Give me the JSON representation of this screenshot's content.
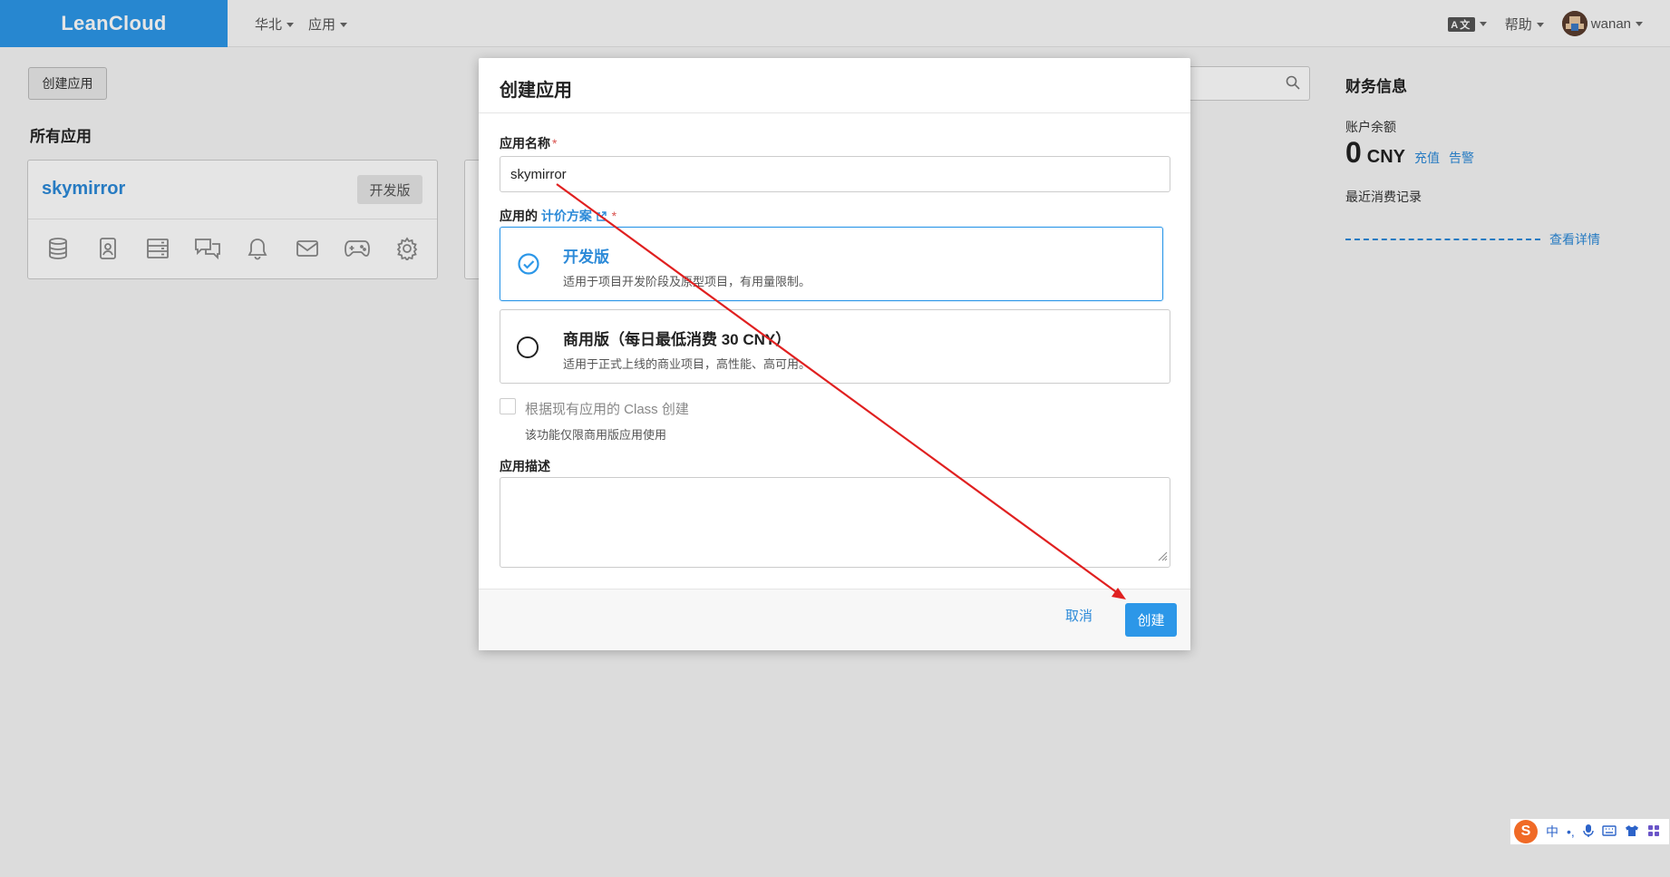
{
  "navbar": {
    "brand": "LeanCloud",
    "region": "华北",
    "apps": "应用",
    "lang_icon": "A文",
    "help": "帮助",
    "user": "wanan"
  },
  "page": {
    "create_button": "创建应用",
    "all_apps_title": "所有应用",
    "app_card": {
      "name": "skymirror",
      "badge": "开发版"
    }
  },
  "finance": {
    "title": "财务信息",
    "balance_label": "账户余额",
    "balance_value": "0",
    "currency": "CNY",
    "recharge": "充值",
    "alert": "告警",
    "recent_label": "最近消费记录",
    "details": "查看详情"
  },
  "modal": {
    "title": "创建应用",
    "name_label": "应用名称",
    "name_value": "skymirror",
    "plan_label_prefix": "应用的",
    "plan_link": "计价方案",
    "required_mark": "*",
    "plans": [
      {
        "title": "开发版",
        "desc": "适用于项目开发阶段及原型项目，有用量限制。",
        "selected": true
      },
      {
        "title": "商用版（每日最低消费 30 CNY）",
        "desc": "适用于正式上线的商业项目，高性能、高可用。",
        "selected": false
      }
    ],
    "class_checkbox_label": "根据现有应用的 Class 创建",
    "class_checkbox_help": "该功能仅限商用版应用使用",
    "desc_label": "应用描述",
    "cancel": "取消",
    "create": "创建"
  },
  "ime": {
    "mode": "中",
    "punct": "•,"
  },
  "colors": {
    "primary": "#2c97e8",
    "link": "#2c8ad8",
    "annotation": "#e02020"
  }
}
